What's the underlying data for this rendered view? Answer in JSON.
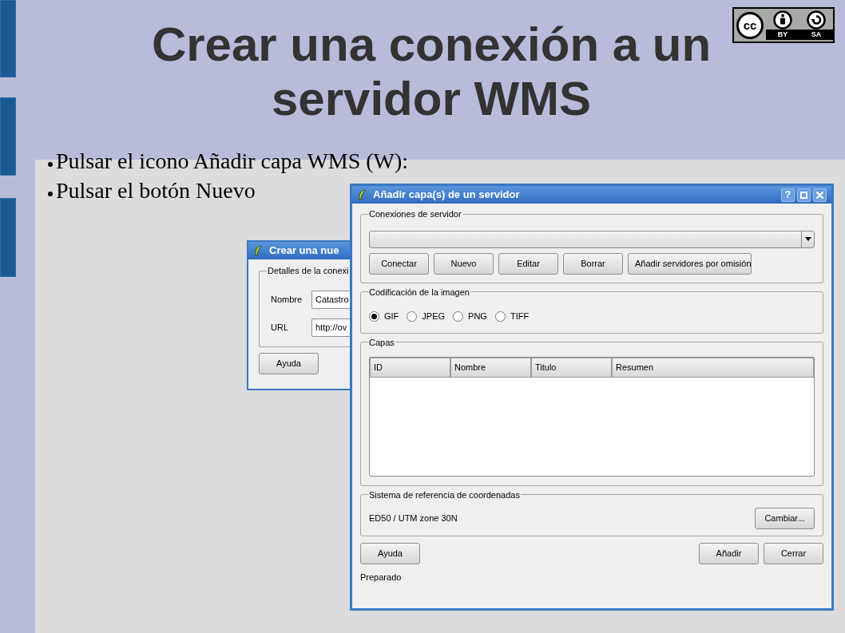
{
  "slide": {
    "title_lines": [
      "Crear una conexión a un",
      "servidor WMS"
    ],
    "license": {
      "badge": "cc",
      "labels": [
        "BY",
        "SA"
      ]
    },
    "bullets": [
      "Pulsar el icono Añadir capa WMS (W):",
      "Pulsar el botón Nuevo"
    ]
  },
  "back_dialog": {
    "title": "Crear una nue",
    "group": "Detalles de la conexi",
    "fields": [
      {
        "label": "Nombre",
        "value": "Catastro"
      },
      {
        "label": "URL",
        "value": "http://ov"
      }
    ],
    "button": "Ayuda"
  },
  "dialog": {
    "title": "Añadir capa(s) de un servidor",
    "title_buttons": [
      "?"
    ],
    "connections": {
      "title": "Conexiones de servidor",
      "buttons": [
        "Conectar",
        "Nuevo",
        "Editar",
        "Borrar",
        "Añadir servidores por omisión"
      ]
    },
    "encoding": {
      "title": "Codificación de la imagen",
      "formats": [
        {
          "label": "GIF",
          "selected": true
        },
        {
          "label": "JPEG",
          "selected": false
        },
        {
          "label": "PNG",
          "selected": false
        },
        {
          "label": "TIFF",
          "selected": false
        }
      ]
    },
    "layers": {
      "title": "Capas",
      "columns": [
        "ID",
        "Nombre",
        "Titulo",
        "Resumen"
      ]
    },
    "crs": {
      "title": "Sistema de referencia de coordenadas",
      "value": "ED50 / UTM zone 30N",
      "button": "Cambiar..."
    },
    "buttons_left": [
      "Ayuda"
    ],
    "buttons_right": [
      "Añadir",
      "Cerrar"
    ],
    "status": "Preparado"
  }
}
